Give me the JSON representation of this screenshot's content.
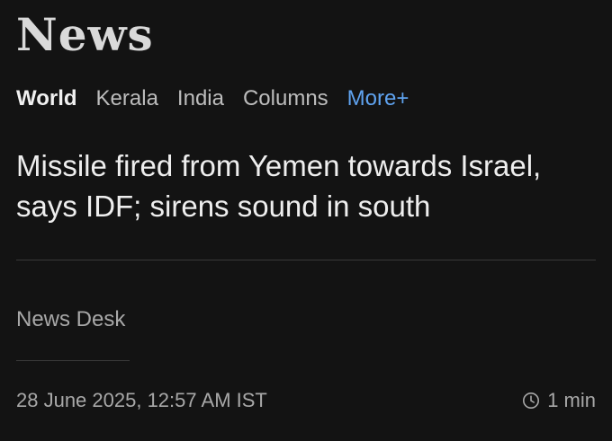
{
  "header": {
    "brand": "News"
  },
  "nav": {
    "items": [
      {
        "label": "World",
        "active": true
      },
      {
        "label": "Kerala"
      },
      {
        "label": "India"
      },
      {
        "label": "Columns"
      },
      {
        "label": "More+"
      }
    ]
  },
  "article": {
    "headline": "Missile fired from Yemen towards Israel, says IDF; sirens sound in south",
    "author": "News Desk",
    "timestamp": "28 June 2025, 12:57 AM IST",
    "read_time": "1 min",
    "read_time_icon": "clock-icon"
  },
  "colors": {
    "background": "#131313",
    "accent": "#5fa3f0",
    "text": "#eeeeee",
    "muted": "#a8a8a8"
  }
}
